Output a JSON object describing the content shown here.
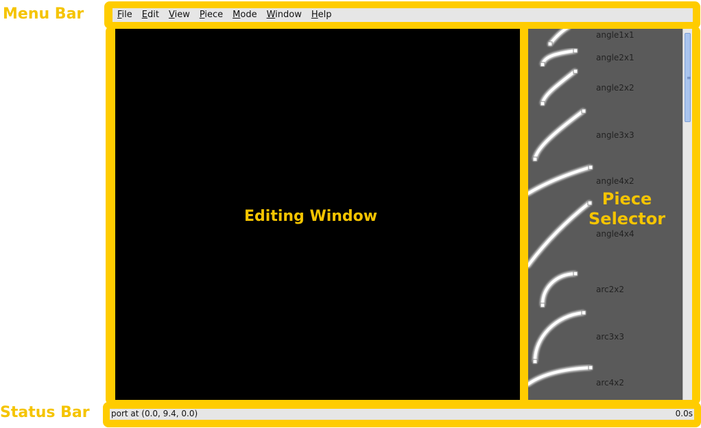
{
  "callouts": {
    "menu_bar": "Menu Bar",
    "status_bar": "Status Bar",
    "editing_window": "Editing Window",
    "piece_selector_line1": "Piece",
    "piece_selector_line2": "Selector"
  },
  "colors": {
    "highlight": "#ffcc00",
    "callout_text": "#f5c400",
    "editor_bg": "#000000",
    "selector_bg": "#5a5a5a"
  },
  "menu": {
    "items": [
      {
        "mnemonic": "F",
        "rest": "ile"
      },
      {
        "mnemonic": "E",
        "rest": "dit"
      },
      {
        "mnemonic": "V",
        "rest": "iew"
      },
      {
        "mnemonic": "P",
        "rest": "iece"
      },
      {
        "mnemonic": "M",
        "rest": "ode"
      },
      {
        "mnemonic": "W",
        "rest": "indow"
      },
      {
        "mnemonic": "H",
        "rest": "elp"
      }
    ]
  },
  "pieces": [
    {
      "label": "angle1x1"
    },
    {
      "label": "angle2x1"
    },
    {
      "label": "angle2x2"
    },
    {
      "label": "angle3x3"
    },
    {
      "label": "angle4x2"
    },
    {
      "label": "angle4x4"
    },
    {
      "label": "arc2x2"
    },
    {
      "label": "arc3x3"
    },
    {
      "label": "arc4x2"
    }
  ],
  "status": {
    "message": "port at (0.0, 9.4, 0.0)",
    "time": "0.0s"
  }
}
